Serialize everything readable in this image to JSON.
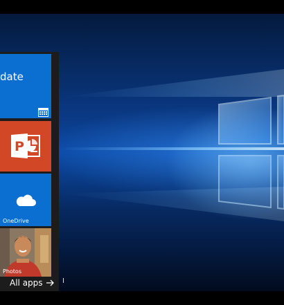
{
  "start_menu": {
    "tiles": [
      {
        "name": "calendar",
        "text": "date"
      },
      {
        "name": "powerpoint",
        "text": ""
      },
      {
        "name": "onedrive",
        "label": "OneDrive"
      },
      {
        "name": "photos",
        "label": "Photos"
      }
    ],
    "all_apps_label": "All apps"
  },
  "colors": {
    "tile_blue": "#0a6fd1",
    "powerpoint_orange": "#d24726",
    "menu_background": "#1c1c1c",
    "desktop_accent": "#2e8cff"
  },
  "icons": [
    "calendar-icon",
    "powerpoint-icon",
    "cloud-icon",
    "arrow-right-icon"
  ]
}
